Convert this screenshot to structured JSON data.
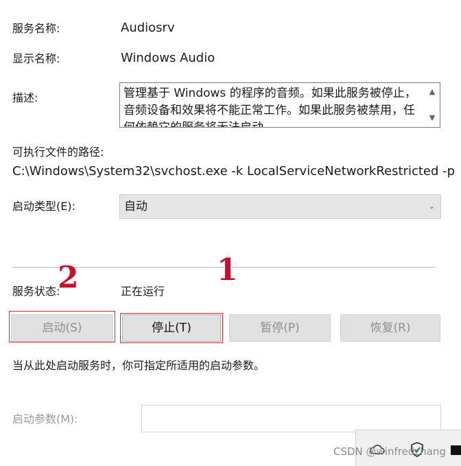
{
  "fields": {
    "service_name_label": "服务名称:",
    "service_name_value": "Audiosrv",
    "display_name_label": "显示名称:",
    "display_name_value": "Windows Audio",
    "description_label": "描述:",
    "description_value": "管理基于 Windows 的程序的音频。如果此服务被停止，音频设备和效果将不能正常工作。如果此服务被禁用，任何依赖它的服务将无法启动",
    "path_label": "可执行文件的路径:",
    "path_value": "C:\\Windows\\System32\\svchost.exe -k LocalServiceNetworkRestricted -p",
    "startup_type_label": "启动类型(E):",
    "startup_type_value": "自动",
    "status_label": "服务状态:",
    "status_value": "正在运行",
    "hint_text": "当从此处启动服务时，你可指定所适用的启动参数。",
    "start_params_label": "启动参数(M):",
    "start_params_value": ""
  },
  "buttons": {
    "start": "启动(S)",
    "stop": "停止(T)",
    "pause": "暂停(P)",
    "resume": "恢复(R)"
  },
  "annotations": {
    "one": "1",
    "two": "2"
  },
  "watermark": "CSDN @winfredzhang",
  "colors": {
    "annotation_red": "#d8232a",
    "button_bg": "#e1e1e1",
    "combo_bg": "#e5e5e5",
    "disabled_text": "#8f8f8f"
  }
}
